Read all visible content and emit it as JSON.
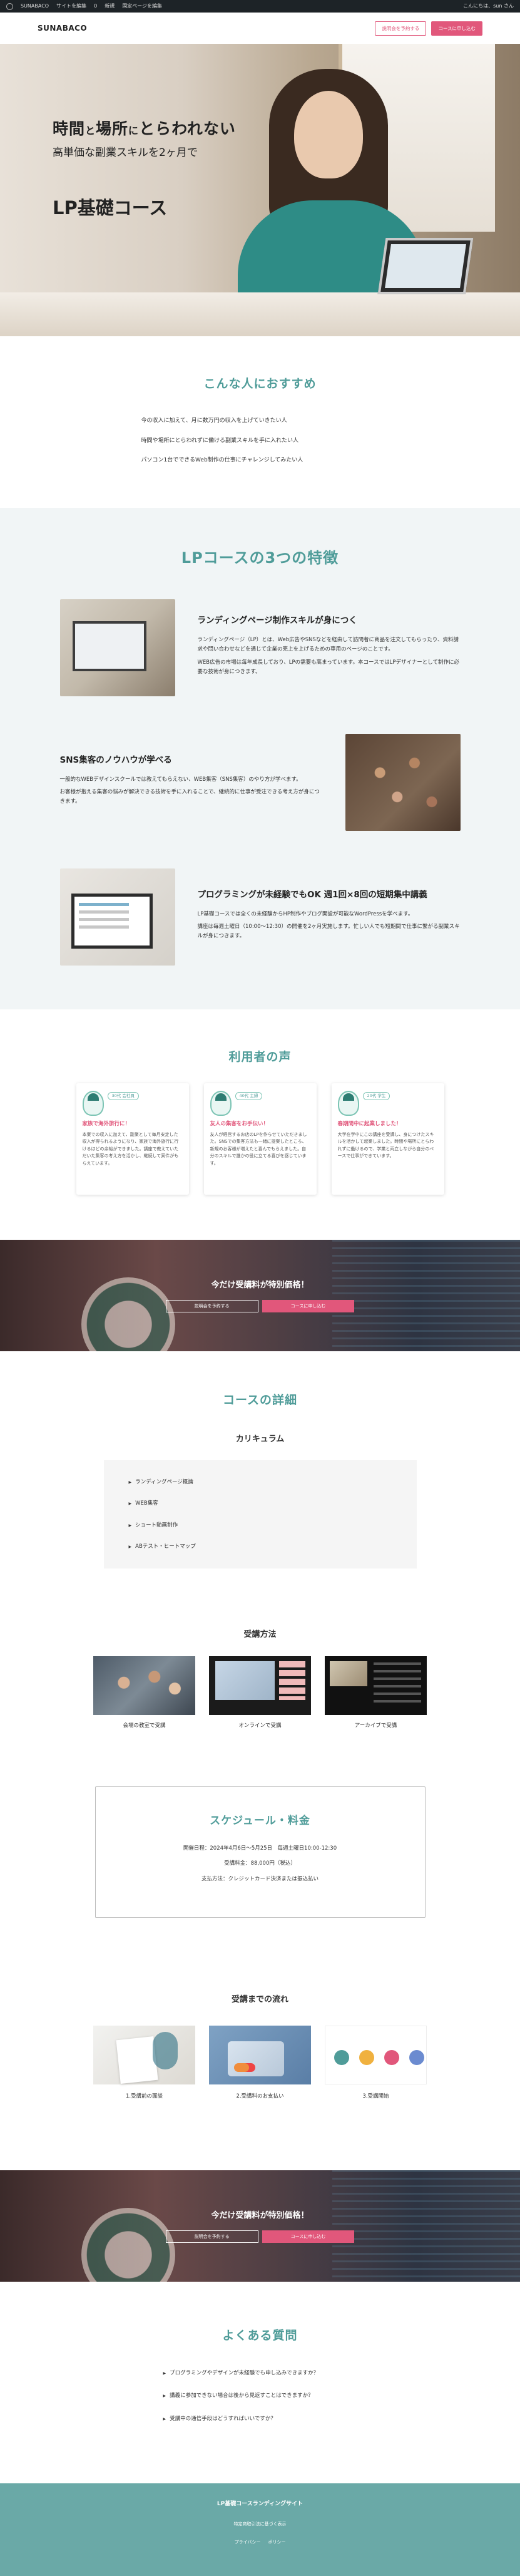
{
  "adminbar": {
    "site": "SUNABACO",
    "customize": "サイトを編集",
    "comments": "0",
    "new": "新規",
    "edit": "固定ページを編集",
    "greeting": "こんにちは、sun さん"
  },
  "header": {
    "logo": "SUNABACO",
    "btn_reserve": "説明会を予約する",
    "btn_apply": "コースに申し込む"
  },
  "hero": {
    "line1a": "時間",
    "line1b": "と",
    "line1c": "場所",
    "line1d": "に",
    "line1e": "とらわれない",
    "line2": "高単価な副業スキルを2ヶ月で",
    "course": "LP基礎コース"
  },
  "recommend": {
    "title": "こんな人におすすめ",
    "items": [
      "今の収入に加えて、月に数万円の収入を上げていきたい人",
      "時間や場所にとらわれずに働ける副業スキルを手に入れたい人",
      "パソコン1台でできるWeb制作の仕事にチャレンジしてみたい人"
    ]
  },
  "features": {
    "title": "LPコースの3つの特徴",
    "items": [
      {
        "heading": "ランディングページ制作スキルが身につく",
        "p1": "ランディングページ（LP）とは、Web広告やSNSなどを経由して訪問者に商品を注文してもらったり、資料請求や問い合わせなどを通じて企業の売上を上げるための専用のページのことです。",
        "p2": "WEB広告の市場は毎年成長しており、LPの需要も高まっています。本コースではLPデザイナーとして制作に必要な技術が身につきます。"
      },
      {
        "heading": "SNS集客のノウハウが学べる",
        "p1": "一般的なWEBデザインスクールでは教えてもらえない、WEB集客（SNS集客）のやり方が学べます。",
        "p2": "お客様が抱える集客の悩みが解決できる技術を手に入れることで、継続的に仕事が受注できる考え方が身につきます。"
      },
      {
        "heading": "プログラミングが未経験でもOK 週1回×8回の短期集中講義",
        "p1": "LP基礎コースでは全くの未経験からHP制作やブログ開設が可能なWordPressを学べます。",
        "p2": "講座は毎週土曜日（10:00〜12:30）の開催を2ヶ月実施します。忙しい人でも短期間で仕事に繋がる副業スキルが身につきます。"
      }
    ]
  },
  "voices": {
    "title": "利用者の声",
    "items": [
      {
        "tag": "30代 会社員",
        "headline": "家族で海外旅行に！",
        "body": "本業での収入に加えて、副業として毎月安定した収入が得られるようになり、家族で海外旅行に行けるほどの余裕ができました。講座で教えていただいた集客の考え方を活かし、継続して案件がもらえています。"
      },
      {
        "tag": "40代 主婦",
        "headline": "友人の集客をお手伝い！",
        "body": "友人が経営するお店のLPを作らせていただきました。SNSでの集客方法も一緒に提案したところ、新規のお客様が増えたと喜んでもらえました。自分のスキルで誰かの役に立てる喜びを感じています。"
      },
      {
        "tag": "20代 学生",
        "headline": "春期間中に起業しました！",
        "body": "大学在学中にこの講座を受講し、身につけたスキルを活かして起業しました。時間や場所にとらわれずに働けるので、学業と両立しながら自分のペースで仕事ができています。"
      }
    ]
  },
  "cta": {
    "title": "今だけ受講料が特別価格！",
    "btn_reserve": "説明会を予約する",
    "btn_apply": "コースに申し込む"
  },
  "detail": {
    "title": "コースの詳細",
    "curriculum_title": "カリキュラム",
    "curriculum": [
      "ランディングページ概論",
      "WEB集客",
      "ショート動画制作",
      "ABテスト・ヒートマップ"
    ],
    "methods_title": "受講方法",
    "methods": [
      "会場の教室で受講",
      "オンラインで受講",
      "アーカイブで受講"
    ]
  },
  "schedule": {
    "title": "スケジュール・料金",
    "dates": "開催日程：2024年4月6日〜5月25日　毎週土曜日10:00-12:30",
    "fee": "受講料金：88,000円（税込）",
    "payment": "支払方法：クレジットカード決済または振込払い"
  },
  "flow": {
    "title": "受講までの流れ",
    "steps": [
      "1.受講前の面談",
      "2.受講料のお支払い",
      "3.受講開始"
    ]
  },
  "faq": {
    "title": "よくある質問",
    "items": [
      "プログラミングやデザインが未経験でも申し込みできますか？",
      "講義に参加できない場合は後から見返すことはできますか？",
      "受講中の通信手段はどうすればいいですか？"
    ]
  },
  "footer": {
    "name": "LP基礎コースランディングサイト",
    "sub": "特定商取引法に基づく表示",
    "link1": "プライバシー",
    "link2": "ポリシー"
  }
}
